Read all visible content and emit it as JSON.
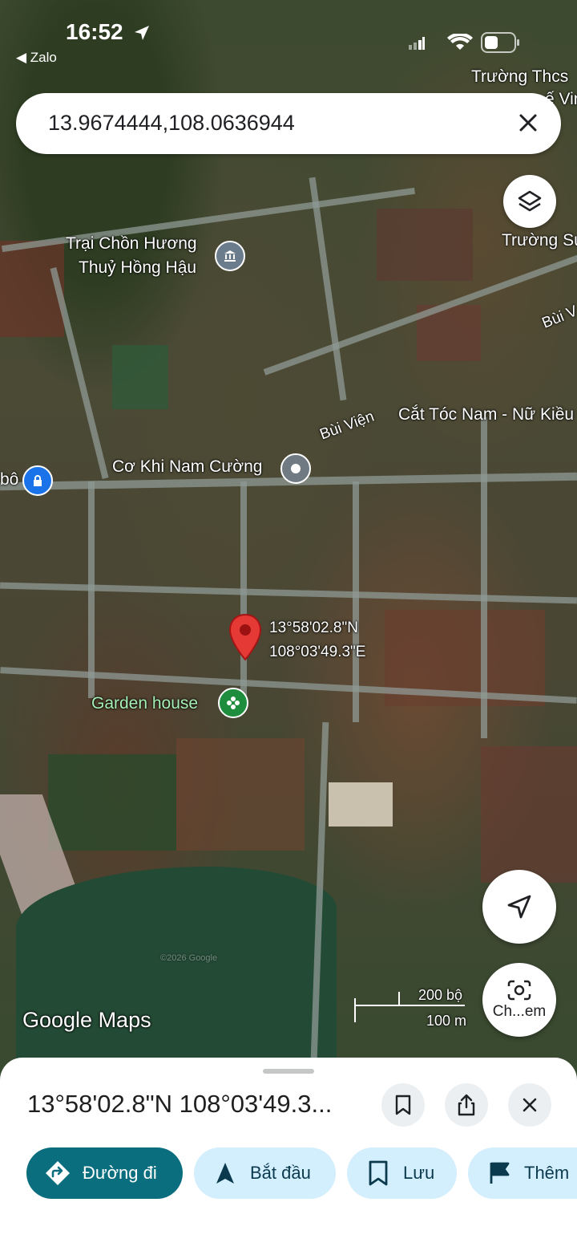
{
  "status_bar": {
    "time": "16:52",
    "back_app": "Zalo"
  },
  "search": {
    "value": "13.9674444,108.0636944"
  },
  "map": {
    "labels": {
      "school_top": "Trường Thcs",
      "school_top2": "ế Vin",
      "school_right": "Trường Su",
      "place_1": "Trại Chồn Hương",
      "place_1b": "Thuỷ Hồng Hậu",
      "road_1": "Bùi Viện",
      "road_2": "Bùi V",
      "barber": "Cắt Tóc Nam - Nữ Kiều",
      "mechanic": "Cơ Khi Nam Cường",
      "left_edge": "bô",
      "garden": "Garden house",
      "coord_lat": "13°58'02.8\"N",
      "coord_lng": "108°03'49.3\"E",
      "copyright": "©2026 Google"
    },
    "brand": "Google Maps",
    "scale": {
      "feet": "200 bộ",
      "meters": "100 m"
    },
    "lens_label": "Ch...em"
  },
  "sheet": {
    "title": "13°58'02.8\"N 108°03'49.3...",
    "chips": {
      "directions": "Đường đi",
      "start": "Bắt đầu",
      "save": "Lưu",
      "more": "Thêm"
    }
  },
  "colors": {
    "accent": "#0b6e7e",
    "chip_bg": "#d3eefc",
    "pin": "#e53935"
  }
}
